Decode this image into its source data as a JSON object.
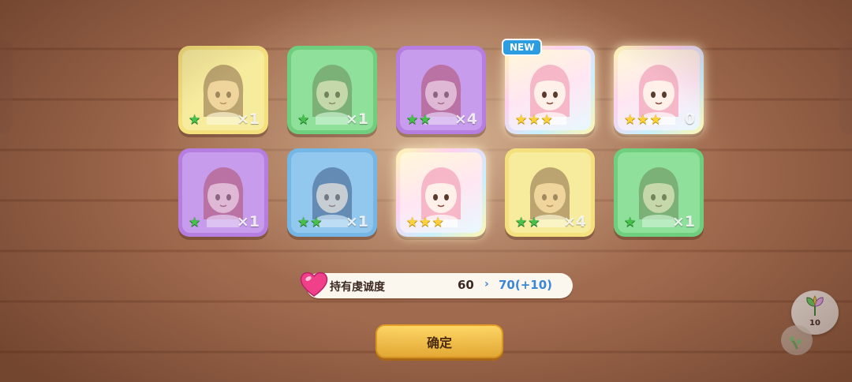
{
  "cards": [
    {
      "color": "yellow",
      "star_type": "green",
      "stars": 1,
      "count": "×1",
      "new": false
    },
    {
      "color": "green",
      "star_type": "green",
      "stars": 1,
      "count": "×1",
      "new": false
    },
    {
      "color": "purple",
      "star_type": "green",
      "stars": 2,
      "count": "×4",
      "new": false
    },
    {
      "color": "holo",
      "star_type": "gold",
      "stars": 3,
      "count": "",
      "new": true
    },
    {
      "color": "holo",
      "star_type": "gold",
      "stars": 3,
      "count": "0",
      "new": false
    },
    {
      "color": "purple",
      "star_type": "green",
      "stars": 1,
      "count": "×1",
      "new": false
    },
    {
      "color": "blue",
      "star_type": "green",
      "stars": 2,
      "count": "×1",
      "new": false
    },
    {
      "color": "holo",
      "star_type": "gold",
      "stars": 3,
      "count": "",
      "new": false
    },
    {
      "color": "yellow",
      "star_type": "green",
      "stars": 2,
      "count": "×4",
      "new": false
    },
    {
      "color": "green",
      "star_type": "green",
      "stars": 1,
      "count": "×1",
      "new": false
    }
  ],
  "new_badge_label": "NEW",
  "devotion": {
    "label": "持有虔诚度",
    "current": "60",
    "next": "70(+10)",
    "icon": "heart-icon"
  },
  "confirm_label": "确定",
  "item": {
    "count": "10",
    "icon": "leaf-icon"
  },
  "colors": {
    "accent_blue": "#3a86d8",
    "button_yellow": "#f6b93a"
  }
}
